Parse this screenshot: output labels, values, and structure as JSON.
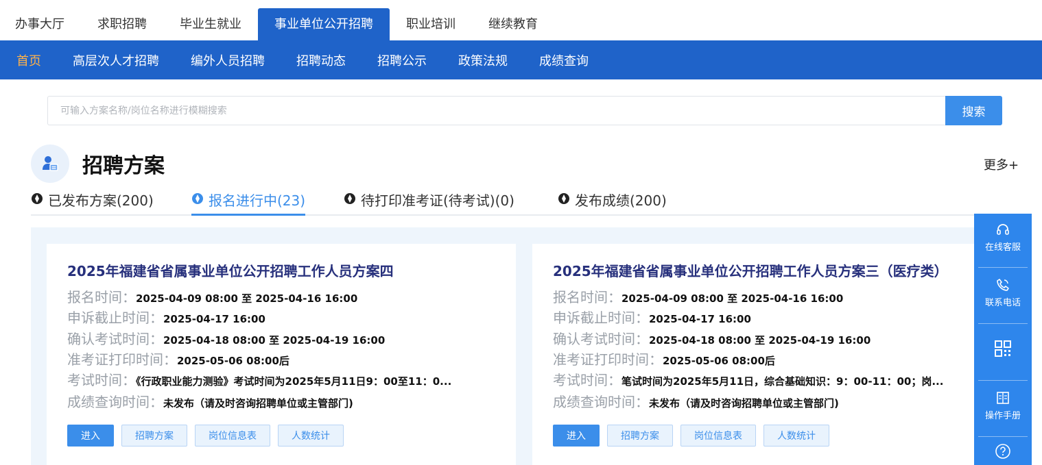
{
  "top_tabs": [
    "办事大厅",
    "求职招聘",
    "毕业生就业",
    "事业单位公开招聘",
    "职业培训",
    "继续教育"
  ],
  "nav": [
    "首页",
    "高层次人才招聘",
    "编外人员招聘",
    "招聘动态",
    "招聘公示",
    "政策法规",
    "成绩查询"
  ],
  "search": {
    "placeholder": "可输入方案名称/岗位名称进行模糊搜索",
    "button": "搜索"
  },
  "section": {
    "title": "招聘方案",
    "more": "更多+"
  },
  "sub_tabs": [
    "已发布方案(200)",
    "报名进行中(23)",
    "待打印准考证(待考试)(0)",
    "发布成绩(200)"
  ],
  "cards": [
    {
      "title": "2025年福建省省属事业单位公开招聘工作人员方案四",
      "rows": [
        {
          "label": "报名时间：",
          "value": "2025-04-09 08:00 至 2025-04-16 16:00"
        },
        {
          "label": "申诉截止时间：",
          "value": "2025-04-17 16:00"
        },
        {
          "label": "确认考试时间：",
          "value": "2025-04-18 08:00 至 2025-04-19 16:00"
        },
        {
          "label": "准考证打印时间：",
          "value": "2025-05-06 08:00后"
        },
        {
          "label": "考试时间：",
          "value": "《行政职业能力测验》考试时间为2025年5月11日9：00至11：0..."
        },
        {
          "label": "成绩查询时间：",
          "value": "未发布（请及时咨询招聘单位或主管部门)"
        }
      ],
      "buttons": [
        "进入",
        "招聘方案",
        "岗位信息表",
        "人数统计"
      ]
    },
    {
      "title": "2025年福建省省属事业单位公开招聘工作人员方案三（医疗类）",
      "rows": [
        {
          "label": "报名时间：",
          "value": "2025-04-09 08:00 至 2025-04-16 16:00"
        },
        {
          "label": "申诉截止时间：",
          "value": "2025-04-17 16:00"
        },
        {
          "label": "确认考试时间：",
          "value": "2025-04-18 08:00 至 2025-04-19 16:00"
        },
        {
          "label": "准考证打印时间：",
          "value": "2025-05-06 08:00后"
        },
        {
          "label": "考试时间：",
          "value": "笔试时间为2025年5月11日，综合基础知识：9：00-11：00；岗..."
        },
        {
          "label": "成绩查询时间：",
          "value": "未发布（请及时咨询招聘单位或主管部门)"
        }
      ],
      "buttons": [
        "进入",
        "招聘方案",
        "岗位信息表",
        "人数统计"
      ]
    }
  ],
  "float_bar": [
    {
      "label": "在线客服",
      "icon": "headset-icon"
    },
    {
      "label": "联系电话",
      "icon": "phone-icon"
    },
    {
      "label": "",
      "icon": "qrcode-icon"
    },
    {
      "label": "操作手册",
      "icon": "manual-icon"
    },
    {
      "label": "",
      "icon": "help-icon"
    }
  ],
  "colors": {
    "primary": "#1f63c9",
    "accent": "#3b8eea",
    "nav_active": "#ffb24a",
    "card_title": "#27307c"
  }
}
